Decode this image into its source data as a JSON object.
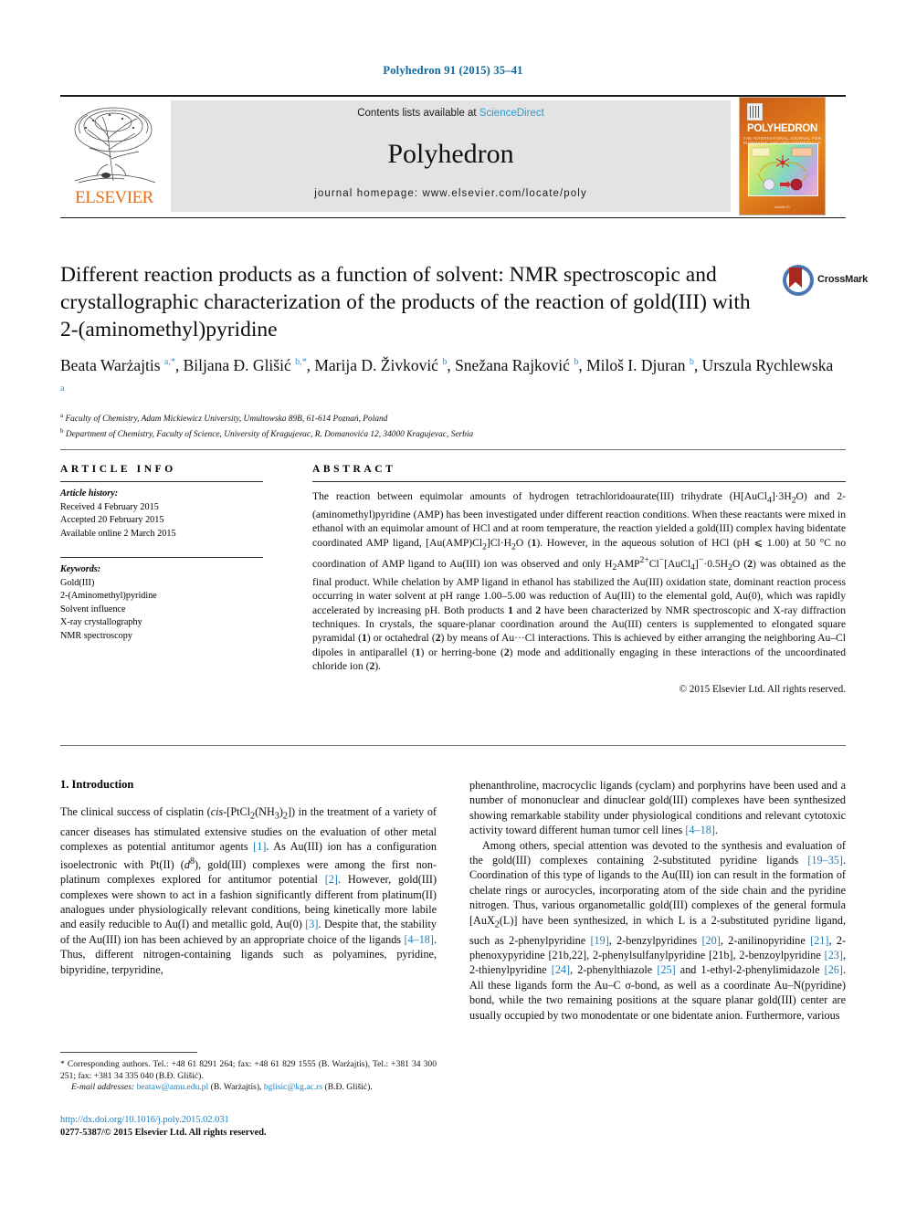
{
  "running_head": "Polyhedron 91 (2015) 35–41",
  "masthead": {
    "contents_prefix": "Contents lists available at ",
    "sciencedirect": "ScienceDirect",
    "journal_title": "Polyhedron",
    "homepage": "journal homepage: www.elsevier.com/locate/poly",
    "publisher_logo_text": "ELSEVIER",
    "cover": {
      "name": "POLYHEDRON",
      "subtitle": "THE INTERNATIONAL JOURNAL FOR INORGANIC AND ORGANOMETALLIC CHEMISTRY",
      "footer": "Volume 91"
    }
  },
  "crossmark": {
    "label": "CrossMark"
  },
  "article": {
    "title": "Different reaction products as a function of solvent: NMR spectroscopic and crystallographic characterization of the products of the reaction of gold(III) with 2-(aminomethyl)pyridine",
    "authors_html": "Beata Warżajtis <sup>a,*</sup>, Biljana Đ. Glišić <sup>b,*</sup>, Marija D. Živković <sup>b</sup>, Snežana Rajković <sup>b</sup>, Miloš I. Djuran <sup>b</sup>, Urszula Rychlewska <sup>a</sup>",
    "affiliation_a": "Faculty of Chemistry, Adam Mickiewicz University, Umultowska 89B, 61-614 Poznań, Poland",
    "affiliation_b": "Department of Chemistry, Faculty of Science, University of Kragujevac, R. Domanovića 12, 34000 Kragujevac, Serbia"
  },
  "article_info": {
    "heading": "ARTICLE INFO",
    "history_label": "Article history:",
    "history": [
      "Received 4 February 2015",
      "Accepted 20 February 2015",
      "Available online 2 March 2015"
    ],
    "keywords_label": "Keywords:",
    "keywords": [
      "Gold(III)",
      "2-(Aminomethyl)pyridine",
      "Solvent influence",
      "X-ray crystallography",
      "NMR spectroscopy"
    ]
  },
  "abstract": {
    "heading": "ABSTRACT",
    "body_html": "The reaction between equimolar amounts of hydrogen tetrachloridoaurate(III) trihydrate (H[AuCl<sub>4</sub>]·3H<sub>2</sub>O) and 2-(aminomethyl)pyridine (AMP) has been investigated under different reaction conditions. When these reactants were mixed in ethanol with an equimolar amount of HCl and at room temperature, the reaction yielded a gold(III) complex having bidentate coordinated AMP ligand, [Au(AMP)Cl<sub>2</sub>]Cl·H<sub>2</sub>O (<b>1</b>). However, in the aqueous solution of HCl (pH ⩽ 1.00) at 50 °C no coordination of AMP ligand to Au(III) ion was observed and only H<sub>2</sub>AMP<sup>2+</sup>Cl<sup>−</sup>[AuCl<sub>4</sub>]<sup>−</sup>·0.5H<sub>2</sub>O (<b>2</b>) was obtained as the final product. While chelation by AMP ligand in ethanol has stabilized the Au(III) oxidation state, dominant reaction process occurring in water solvent at pH range 1.00–5.00 was reduction of Au(III) to the elemental gold, Au(0), which was rapidly accelerated by increasing pH. Both products <b>1</b> and <b>2</b> have been characterized by NMR spectroscopic and X-ray diffraction techniques. In crystals, the square-planar coordination around the Au(III) centers is supplemented to elongated square pyramidal (<b>1</b>) or octahedral (<b>2</b>) by means of Au···Cl interactions. This is achieved by either arranging the neighboring Au–Cl dipoles in antiparallel (<b>1</b>) or herring-bone (<b>2</b>) mode and additionally engaging in these interactions of the uncoordinated chloride ion (<b>2</b>).",
    "copyright": "© 2015 Elsevier Ltd. All rights reserved."
  },
  "introduction": {
    "heading": "1. Introduction",
    "left_paragraph_html": "The clinical success of cisplatin (<i>cis</i>-[PtCl<sub>2</sub>(NH<sub>3</sub>)<sub>2</sub>]) in the treatment of a variety of cancer diseases has stimulated extensive studies on the evaluation of other metal complexes as potential antitumor agents <span class=\"ref\">[1]</span>. As Au(III) ion has a configuration isoelectronic with Pt(II) (<i>d</i><sup>8</sup>), gold(III) complexes were among the first non-platinum complexes explored for antitumor potential <span class=\"ref\">[2]</span>. However, gold(III) complexes were shown to act in a fashion significantly different from platinum(II) analogues under physiologically relevant conditions, being kinetically more labile and easily reducible to Au(I) and metallic gold, Au(0) <span class=\"ref\">[3]</span>. Despite that, the stability of the Au(III) ion has been achieved by an appropriate choice of the ligands <span class=\"ref\">[4–18]</span>. Thus, different nitrogen-containing ligands such as polyamines, pyridine, bipyridine, terpyridine,",
    "right_paragraph_1_html": "phenanthroline, macrocyclic ligands (cyclam) and porphyrins have been used and a number of mononuclear and dinuclear gold(III) complexes have been synthesized showing remarkable stability under physiological conditions and relevant cytotoxic activity toward different human tumor cell lines <span class=\"ref\">[4–18]</span>.",
    "right_paragraph_2_html": "Among others, special attention was devoted to the synthesis and evaluation of the gold(III) complexes containing 2-substituted pyridine ligands <span class=\"ref\">[19–35]</span>. Coordination of this type of ligands to the Au(III) ion can result in the formation of chelate rings or aurocycles, incorporating atom of the side chain and the pyridine nitrogen. Thus, various organometallic gold(III) complexes of the general formula [AuX<sub>2</sub>(L)] have been synthesized, in which L is a 2-substituted pyridine ligand, such as 2-phenylpyridine <span class=\"ref\">[19]</span>, 2-benzylpyridines <span class=\"ref\">[20]</span>, 2-anilinopyridine <span class=\"ref\">[21]</span>, 2-phenoxypyridine [21b,22], 2-phenylsulfanylpyridine [21b], 2-benzoylpyridine <span class=\"ref\">[23]</span>, 2-thienylpyridine <span class=\"ref\">[24]</span>, 2-phenylthiazole <span class=\"ref\">[25]</span> and 1-ethyl-2-phenylimidazole <span class=\"ref\">[26]</span>. All these ligands form the Au–C σ-bond, as well as a coordinate Au–N(pyridine) bond, while the two remaining positions at the square planar gold(III) center are usually occupied by two monodentate or one bidentate anion. Furthermore, various"
  },
  "footnote": {
    "corresponding_html": "* Corresponding authors. Tel.: +48 61 8291 264; fax: +48 61 829 1555 (B. Warżajtis), Tel.: +381 34 300 251; fax: +381 34 335 040 (B.Đ. Glišić).",
    "email_label": "E-mail addresses:",
    "email_1": "beataw@amu.edu.pl",
    "email_1_owner": "(B. Warżajtis),",
    "email_2": "bglisic@kg.ac.rs",
    "email_2_owner": "(B.Đ. Glišić)."
  },
  "doi_block": {
    "doi": "http://dx.doi.org/10.1016/j.poly.2015.02.031",
    "issn_line": "0277-5387/© 2015 Elsevier Ltd. All rights reserved."
  }
}
